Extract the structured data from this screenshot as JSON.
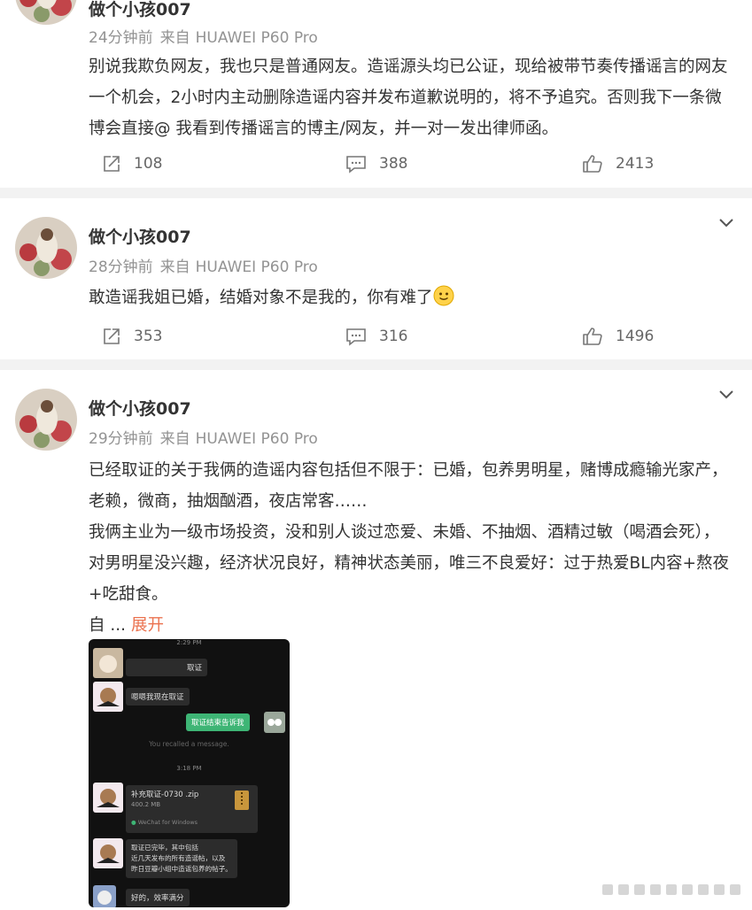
{
  "posts": [
    {
      "username": "做个小孩007",
      "time": "24分钟前",
      "source_prefix": "来自",
      "device": "HUAWEI P60 Pro",
      "text": "别说我欺负网友，我也只是普通网友。造谣源头均已公证，现给被带节奏传播谣言的网友一个机会，2小时内主动删除造谣内容并发布道歉说明的，将不予追究。否则我下一条微博会直接@ 我看到传播谣言的博主/网友，并一对一发出律师函。",
      "reposts": "108",
      "comments": "388",
      "likes": "2413"
    },
    {
      "username": "做个小孩007",
      "time": "28分钟前",
      "source_prefix": "来自",
      "device": "HUAWEI P60 Pro",
      "text": "敢造谣我姐已婚，结婚对象不是我的，你有难了",
      "reposts": "353",
      "comments": "316",
      "likes": "1496"
    },
    {
      "username": "做个小孩007",
      "time": "29分钟前",
      "source_prefix": "来自",
      "device": "HUAWEI P60 Pro",
      "text_p1": "已经取证的关于我俩的造谣内容包括但不限于：已婚，包养男明星，赌博成瘾输光家产，老赖，微商，抽烟酗酒，夜店常客……",
      "text_p2": "我俩主业为一级市场投资，没和别人谈过恋爱、未婚、不抽烟、酒精过敏（喝酒会死），对男明星没兴趣，经济状况良好，精神状态美丽，唯三不良爱好：过于热爱BL内容+熬夜+吃甜食。",
      "text_p3": "自",
      "ellipsis": "...",
      "expand_label": "展开",
      "image": {
        "time1": "2:29 PM",
        "msg1": "取证",
        "msg2": "嗯嗯我现在取证",
        "msg3": "取证结束告诉我",
        "recalled": "You recalled a message.",
        "time2": "3:18 PM",
        "file_name": "补充取证-0730 .zip",
        "file_size": "400.2 MB",
        "file_source": "WeChat for Windows",
        "msg4_line1": "取证已完毕，其中包括",
        "msg4_line2": "近几天发布的所有造谣帖，以及",
        "msg4_line3": "昨日豆瓣小组中造谣包养的帖子。",
        "msg5": "好的，效率满分"
      }
    }
  ],
  "colors": {
    "username": "#333333",
    "meta": "#939393",
    "expand": "#eb7350",
    "separator": "#f2f2f2"
  }
}
